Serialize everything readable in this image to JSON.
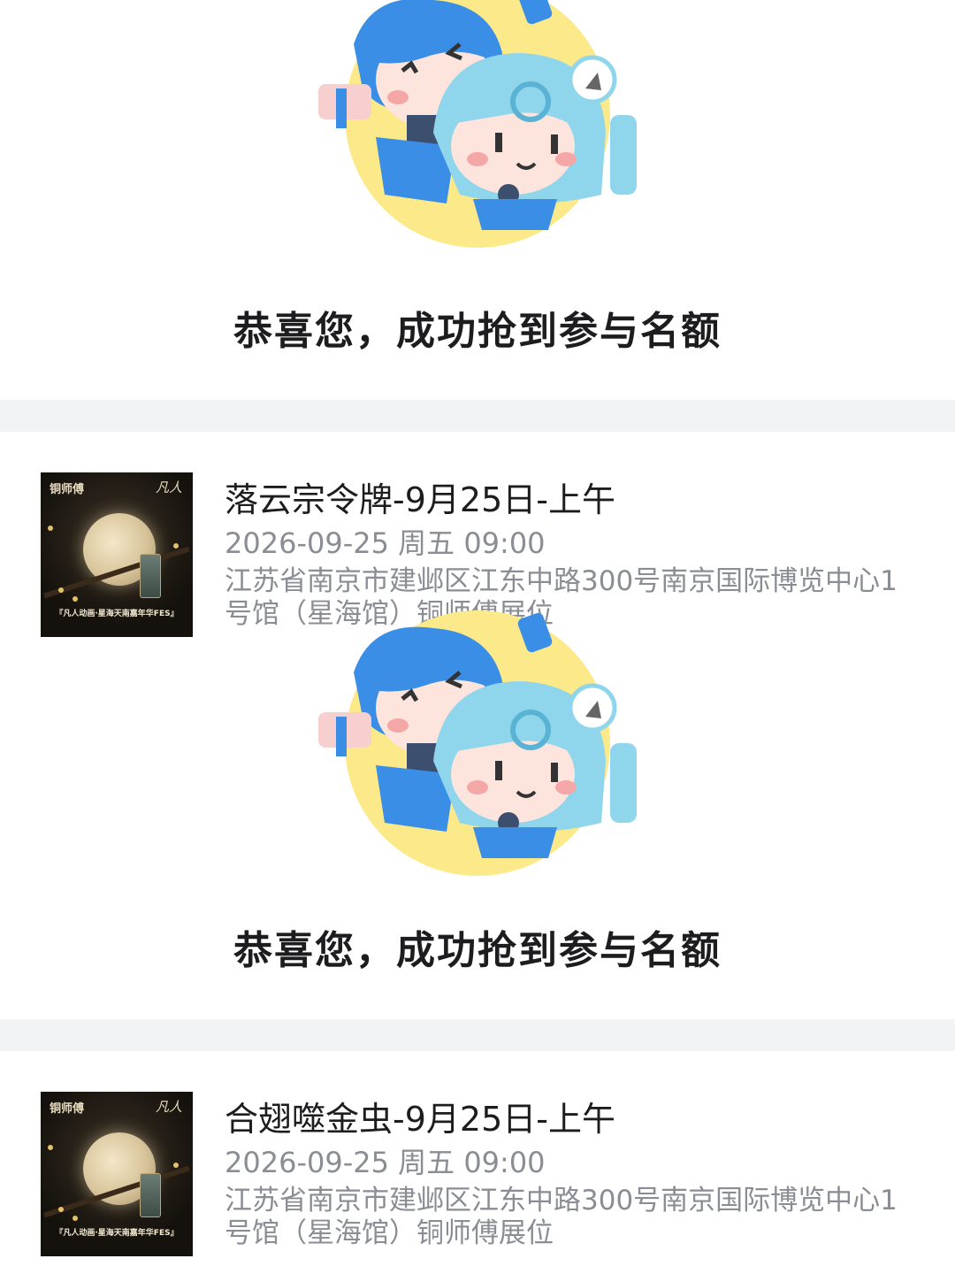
{
  "blocks": [
    {
      "success_message": "恭喜您，成功抢到参与名额",
      "item": {
        "title": "落云宗令牌-9月25日-上午",
        "datetime": "2026-09-25 周五 09:00",
        "address": "江苏省南京市建邺区江东中路300号南京国际博览中心1号馆（星海馆）铜师傅展位",
        "thumb_brand": "铜师傅",
        "thumb_brand2": "凡人",
        "thumb_caption": "『凡人动画·星海天南嘉年华FES』"
      }
    },
    {
      "success_message": "恭喜您，成功抢到参与名额",
      "item": {
        "title": "合翅噬金虫-9月25日-上午",
        "datetime": "2026-09-25 周五 09:00",
        "address": "江苏省南京市建邺区江东中路300号南京国际博览中心1号馆（星海馆）铜师傅展位",
        "thumb_brand": "铜师傅",
        "thumb_brand2": "凡人",
        "thumb_caption": "『凡人动画·星海天南嘉年华FES』"
      }
    }
  ],
  "colors": {
    "divider": "#f2f3f5",
    "title_text": "#1d1d1f",
    "meta_text": "#8a8d94",
    "mascot_blue": "#3a8ee6",
    "mascot_cyan": "#8fd6ec",
    "mascot_yellow": "#fbe98a"
  },
  "icons": [
    "mascot-illustration"
  ]
}
